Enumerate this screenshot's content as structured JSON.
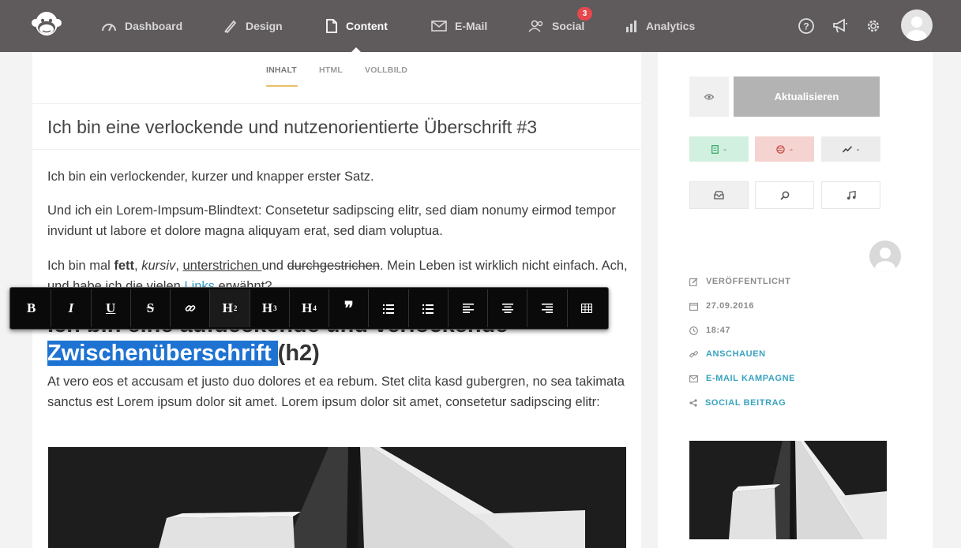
{
  "nav": {
    "items": [
      {
        "label": "Dashboard",
        "icon": "gauge-icon"
      },
      {
        "label": "Design",
        "icon": "brush-icon"
      },
      {
        "label": "Content",
        "icon": "document-icon"
      },
      {
        "label": "E-Mail",
        "icon": "mail-icon"
      },
      {
        "label": "Social",
        "icon": "users-icon"
      },
      {
        "label": "Analytics",
        "icon": "bar-chart-icon"
      }
    ],
    "social_badge": "3",
    "active": "Content"
  },
  "editor": {
    "tabs": [
      "INHALT",
      "HTML",
      "VOLLBILD"
    ],
    "headline": "Ich bin eine verlockende und nutzenorientierte Überschrift #3",
    "p1": "Ich bin ein verlockender, kurzer und knapper erster Satz.",
    "p2": "Und ich ein Lorem-Impsum-Blindtext: Consetetur sadipscing elitr, sed diam nonumy eirmod tempor invidunt ut labore et dolore magna aliquyam erat, sed diam voluptua.",
    "p3": {
      "t1": "Ich bin mal ",
      "bold": "fett",
      "t2": ", ",
      "italic": "kursiv",
      "t3": ", ",
      "underline": "unterstrichen ",
      "t4": "und ",
      "strike": "durchgestrichen",
      "t5": ". Mein Leben ist wirklich nicht einfach. Ach, und habe ich die vielen ",
      "link": "Links",
      "t6": " erwähnt?"
    },
    "h2": {
      "line1": "Ich bin eine aufdeckende und verlockende",
      "selected": "Zwischenüberschrift ",
      "rest": "(h2)"
    },
    "p4": "At vero eos et accusam et justo duo dolores et ea rebum. Stet clita kasd gubergren, no sea takimata sanctus est Lorem ipsum dolor sit amet. Lorem ipsum dolor sit amet, consetetur sadipscing elitr:"
  },
  "toolbar": {
    "bold": "B",
    "italic": "I",
    "underline": "U",
    "strike": "S",
    "h2": "H",
    "h2_sup": "2",
    "h3": "H",
    "h3_sup": "3",
    "h4": "H",
    "h4_sup": "4",
    "quote": "❞"
  },
  "sidebar": {
    "update_label": "Aktualisieren",
    "stats": [
      {
        "value": "-",
        "color": "#3aa86a"
      },
      {
        "value": "-",
        "color": "#c6514a"
      },
      {
        "value": "-",
        "color": "#555555"
      }
    ],
    "meta": {
      "status": "VERÖFFENTLICHT",
      "date": "27.09.2016",
      "time": "18:47",
      "view": "ANSCHAUEN",
      "email": "E-MAIL KAMPAGNE",
      "social": "SOCIAL BEITRAG"
    }
  },
  "colors": {
    "topbar": "#5f5b5c",
    "accent_link": "#38a3c0",
    "selection": "#1e73d2",
    "badge": "#e5484d",
    "tab_underline": "#e8c26a"
  }
}
